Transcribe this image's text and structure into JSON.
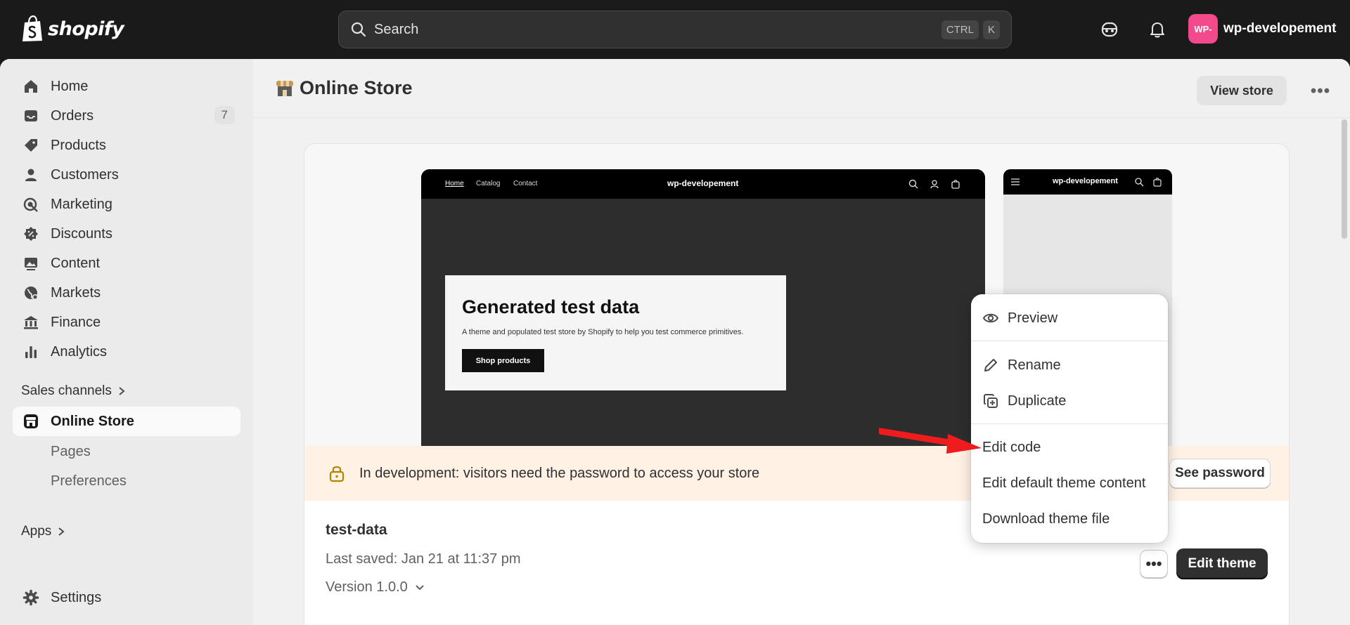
{
  "brand": {
    "name": "shopify"
  },
  "search": {
    "placeholder": "Search",
    "kbd1": "CTRL",
    "kbd2": "K"
  },
  "account": {
    "avatar_text": "WP-",
    "store_name": "wp-developement",
    "avatar_color": "#f24a8c"
  },
  "sidebar": {
    "items": [
      {
        "label": "Home",
        "icon": "home-icon"
      },
      {
        "label": "Orders",
        "icon": "inbox-icon",
        "badge": "7"
      },
      {
        "label": "Products",
        "icon": "tag-icon"
      },
      {
        "label": "Customers",
        "icon": "person-icon"
      },
      {
        "label": "Marketing",
        "icon": "target-icon"
      },
      {
        "label": "Discounts",
        "icon": "discount-icon"
      },
      {
        "label": "Content",
        "icon": "image-icon"
      },
      {
        "label": "Markets",
        "icon": "globe-icon"
      },
      {
        "label": "Finance",
        "icon": "bank-icon"
      },
      {
        "label": "Analytics",
        "icon": "bar-chart-icon"
      }
    ],
    "sales_channels": "Sales channels",
    "online_store": "Online Store",
    "sub_items": [
      "Pages",
      "Preferences"
    ],
    "apps": "Apps",
    "settings": "Settings"
  },
  "page": {
    "title": "Online Store",
    "view_store": "View store",
    "more": "•••"
  },
  "preview": {
    "nav_links": [
      "Home",
      "Catalog",
      "Contact"
    ],
    "brand": "wp-developement",
    "hero_title": "Generated test data",
    "hero_sub": "A theme and populated test store by Shopify to help you test commerce primitives.",
    "hero_button": "Shop products",
    "mobile_brand": "wp-developement"
  },
  "banner": {
    "text": "In development: visitors need the password to access your store",
    "button": "See password"
  },
  "theme": {
    "name": "test-data",
    "saved": "Last saved: Jan 21 at 11:37 pm",
    "version": "Version 1.0.0",
    "dots": "•••",
    "edit": "Edit theme"
  },
  "menu": {
    "preview": "Preview",
    "rename": "Rename",
    "duplicate": "Duplicate",
    "edit_code": "Edit code",
    "edit_default": "Edit default theme content",
    "download": "Download theme file"
  },
  "colors": {
    "accent_arrow": "#ee1c1c",
    "topbar": "#1a1a1a"
  }
}
